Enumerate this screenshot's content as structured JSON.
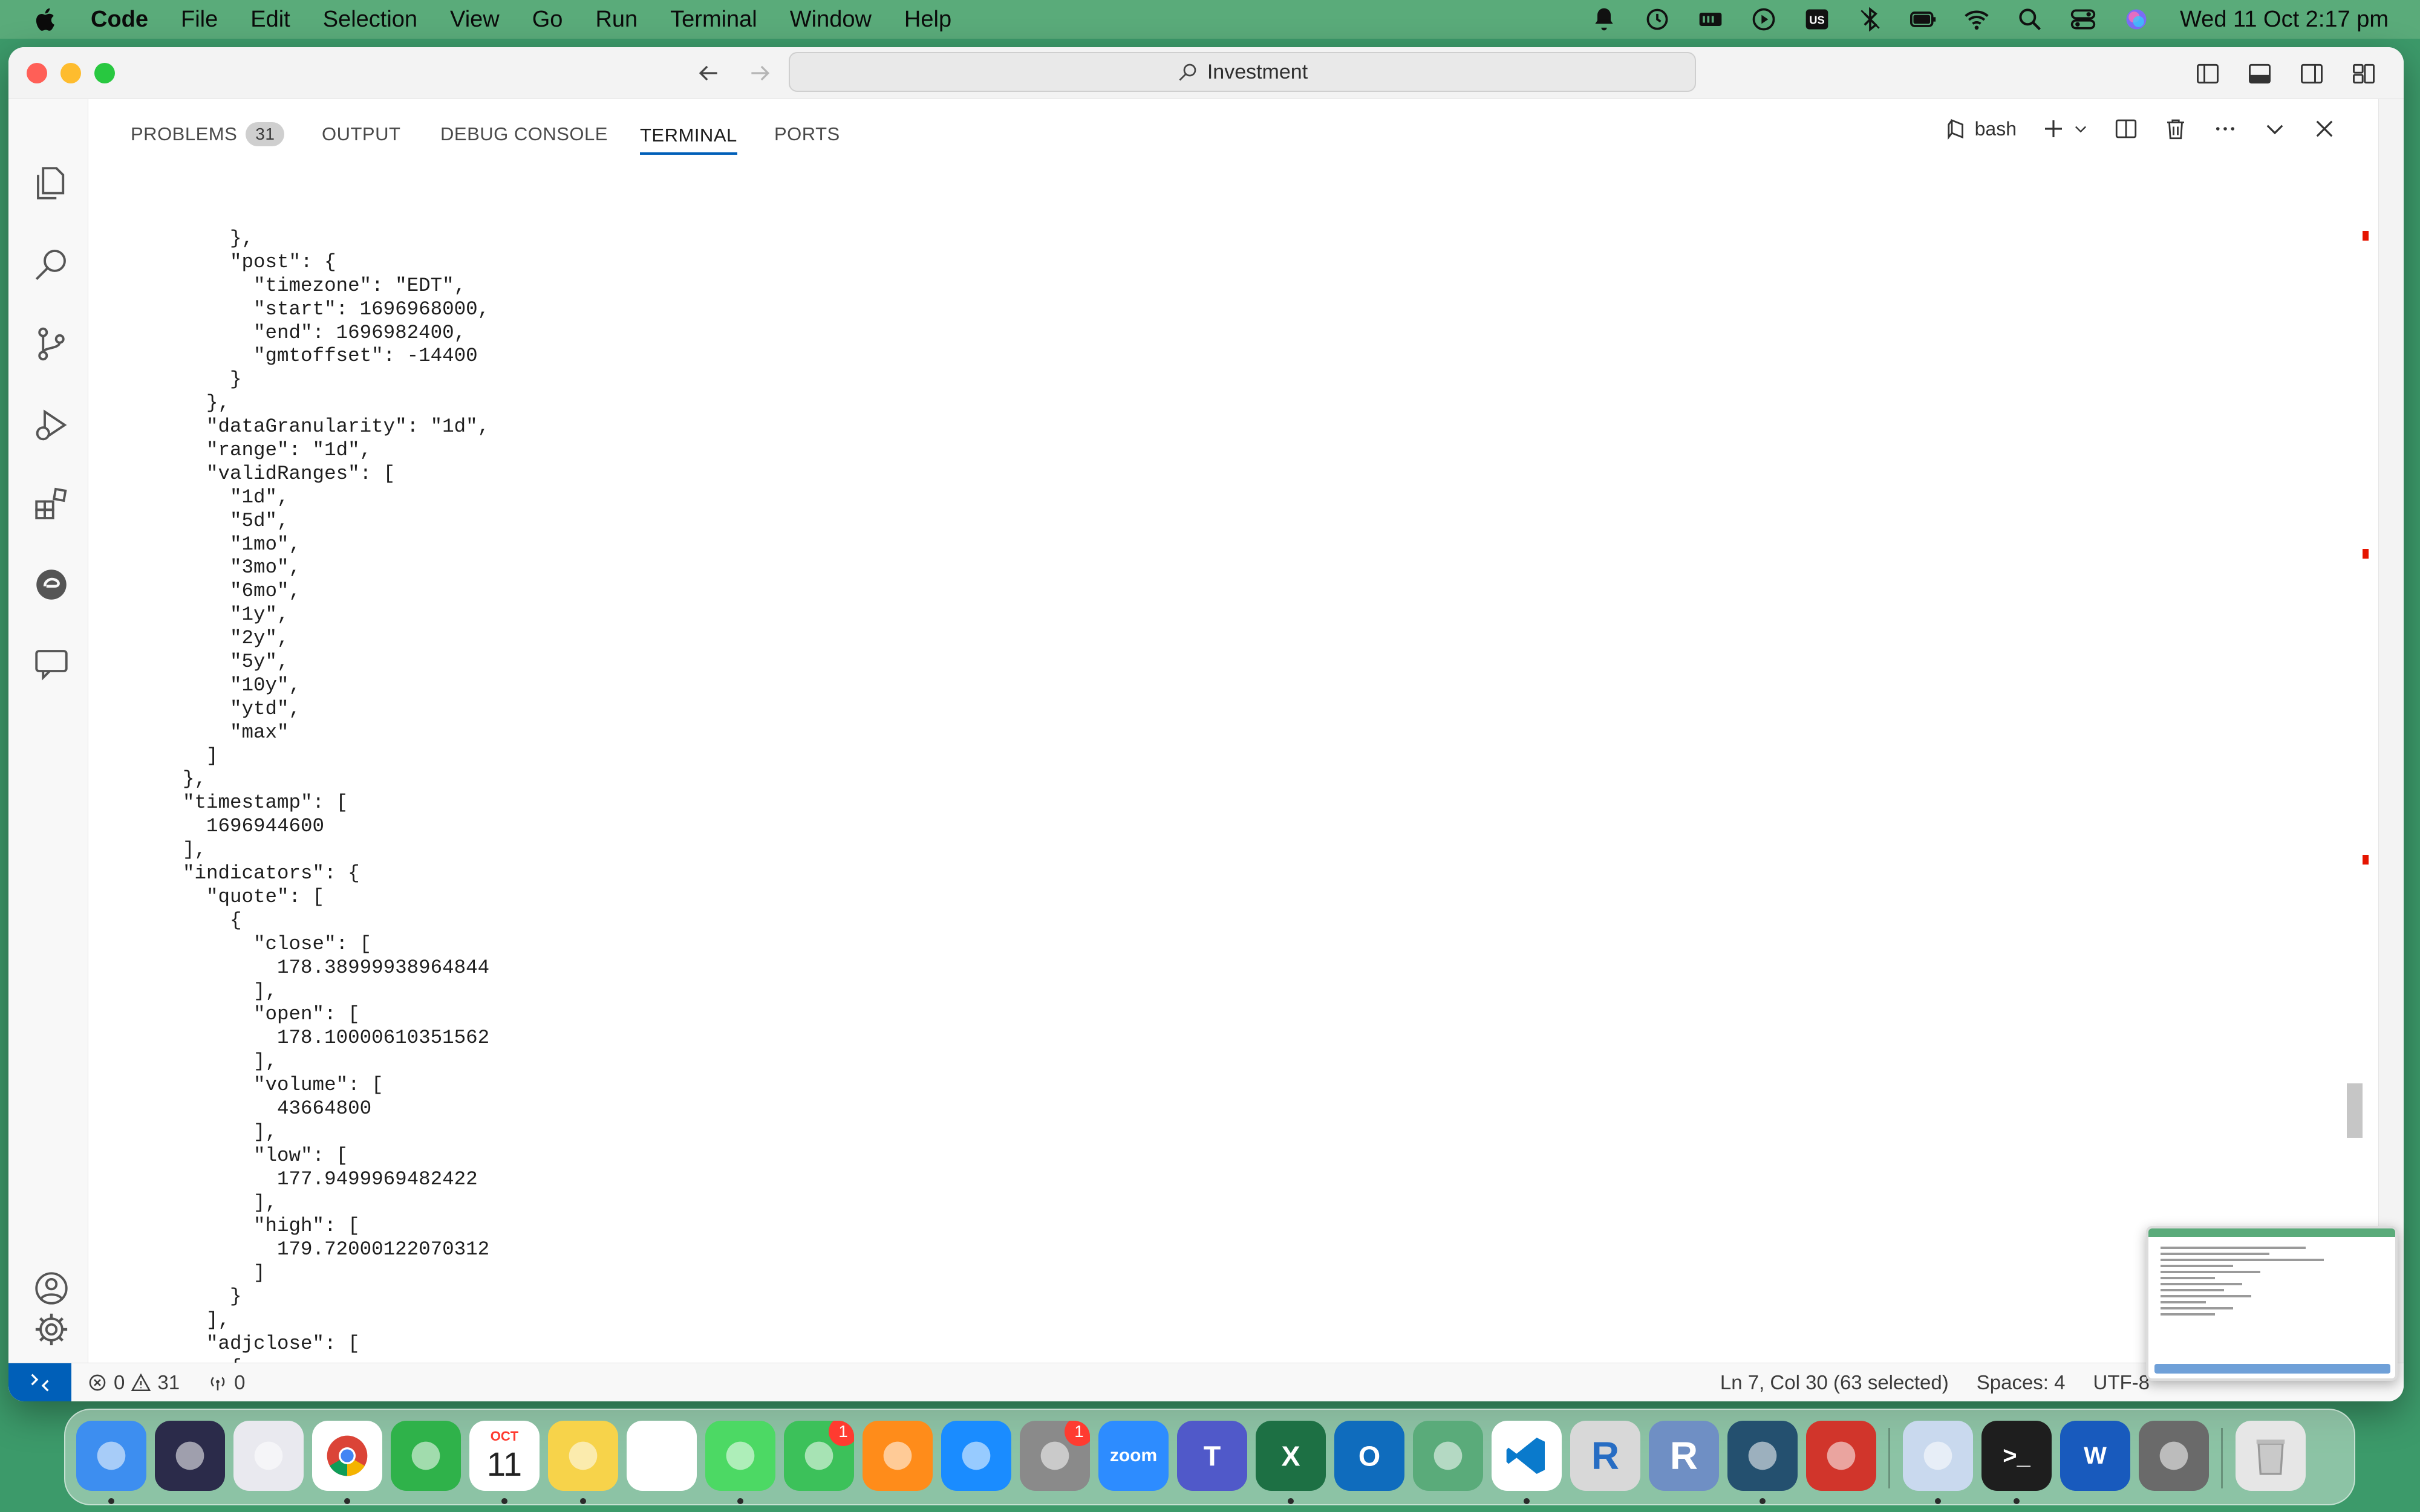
{
  "menubar": {
    "app_name": "Code",
    "items": [
      "File",
      "Edit",
      "Selection",
      "View",
      "Go",
      "Run",
      "Terminal",
      "Window",
      "Help"
    ],
    "status_icons": [
      "notification-bell-icon",
      "time-machine-icon",
      "battery-meter-icon",
      "play-icon",
      "keyboard-input-icon",
      "bluetooth-icon",
      "battery-icon",
      "wifi-icon",
      "spotlight-search-icon",
      "control-center-icon",
      "siri-icon"
    ],
    "keyboard_label": "US",
    "clock": "Wed 11 Oct  2:17 pm"
  },
  "window": {
    "command_center": "Investment"
  },
  "panel": {
    "tabs": [
      {
        "label": "PROBLEMS",
        "badge": "31"
      },
      {
        "label": "OUTPUT"
      },
      {
        "label": "DEBUG CONSOLE"
      },
      {
        "label": "TERMINAL",
        "active": true
      },
      {
        "label": "PORTS"
      }
    ],
    "shell_label": "bash"
  },
  "terminal": {
    "lines": [
      "            },",
      "            \"post\": {",
      "              \"timezone\": \"EDT\",",
      "              \"start\": 1696968000,",
      "              \"end\": 1696982400,",
      "              \"gmtoffset\": -14400",
      "            }",
      "          },",
      "          \"dataGranularity\": \"1d\",",
      "          \"range\": \"1d\",",
      "          \"validRanges\": [",
      "            \"1d\",",
      "            \"5d\",",
      "            \"1mo\",",
      "            \"3mo\",",
      "            \"6mo\",",
      "            \"1y\",",
      "            \"2y\",",
      "            \"5y\",",
      "            \"10y\",",
      "            \"ytd\",",
      "            \"max\"",
      "          ]",
      "        },",
      "        \"timestamp\": [",
      "          1696944600",
      "        ],",
      "        \"indicators\": {",
      "          \"quote\": [",
      "            {",
      "              \"close\": [",
      "                178.38999938964844",
      "              ],",
      "              \"open\": [",
      "                178.10000610351562",
      "              ],",
      "              \"volume\": [",
      "                43664800",
      "              ],",
      "              \"low\": [",
      "                177.9499969482422",
      "              ],",
      "              \"high\": [",
      "                179.72000122070312",
      "              ]",
      "            }",
      "          ],",
      "          \"adjclose\": [",
      "            {",
      "              \"adjclose\": ["
    ]
  },
  "statusbar": {
    "errors": "0",
    "warnings": "31",
    "ports": "0",
    "cursor": "Ln 7, Col 30 (63 selected)",
    "spaces": "Spaces: 4",
    "encoding": "UTF-8"
  },
  "dock": {
    "apps": [
      {
        "name": "Finder",
        "color": "#3d8ef0"
      },
      {
        "name": "Siri",
        "color": "#2b2b4a"
      },
      {
        "name": "Launchpad",
        "color": "#e9e9ef"
      },
      {
        "name": "Chrome",
        "color": "#ffffff"
      },
      {
        "name": "Numbers",
        "color": "#2fb24a"
      },
      {
        "name": "Calendar",
        "color": "#ffffff",
        "month": "OCT",
        "day": "11"
      },
      {
        "name": "Notes",
        "color": "#f7d34a"
      },
      {
        "name": "Reminders",
        "color": "#ffffff"
      },
      {
        "name": "Messages",
        "color": "#4cd964"
      },
      {
        "name": "FaceTime",
        "color": "#3cc15a",
        "badge": "1"
      },
      {
        "name": "Books",
        "color": "#ff8c1a"
      },
      {
        "name": "App Store",
        "color": "#1a8cff"
      },
      {
        "name": "System Settings",
        "color": "#8a8a8a",
        "badge": "1"
      },
      {
        "name": "Zoom",
        "color": "#2d8cff",
        "label": "zoom"
      },
      {
        "name": "Teams",
        "color": "#5059c9"
      },
      {
        "name": "Excel",
        "color": "#1d7044"
      },
      {
        "name": "Outlook",
        "color": "#0f6cbd"
      },
      {
        "name": "Loading",
        "color": "#5aab7a"
      },
      {
        "name": "VS Code",
        "color": "#ffffff"
      },
      {
        "name": "R",
        "color": "#d8d8d8",
        "label": "R"
      },
      {
        "name": "RStudio",
        "color": "#6f8fc4",
        "label": "R"
      },
      {
        "name": "MySQL Workbench",
        "color": "#24506f"
      },
      {
        "name": "Mathematica",
        "color": "#d1352b"
      },
      {
        "name": "Preview",
        "color": "#c9d9ee"
      },
      {
        "name": "Terminal",
        "color": "#1e1e1e",
        "label": ">_"
      },
      {
        "name": "Word",
        "color": "#185abd",
        "label": "W"
      },
      {
        "name": "QuickTime",
        "color": "#6a6a6a"
      },
      {
        "name": "Trash",
        "color": "#e6e6e6"
      }
    ]
  }
}
